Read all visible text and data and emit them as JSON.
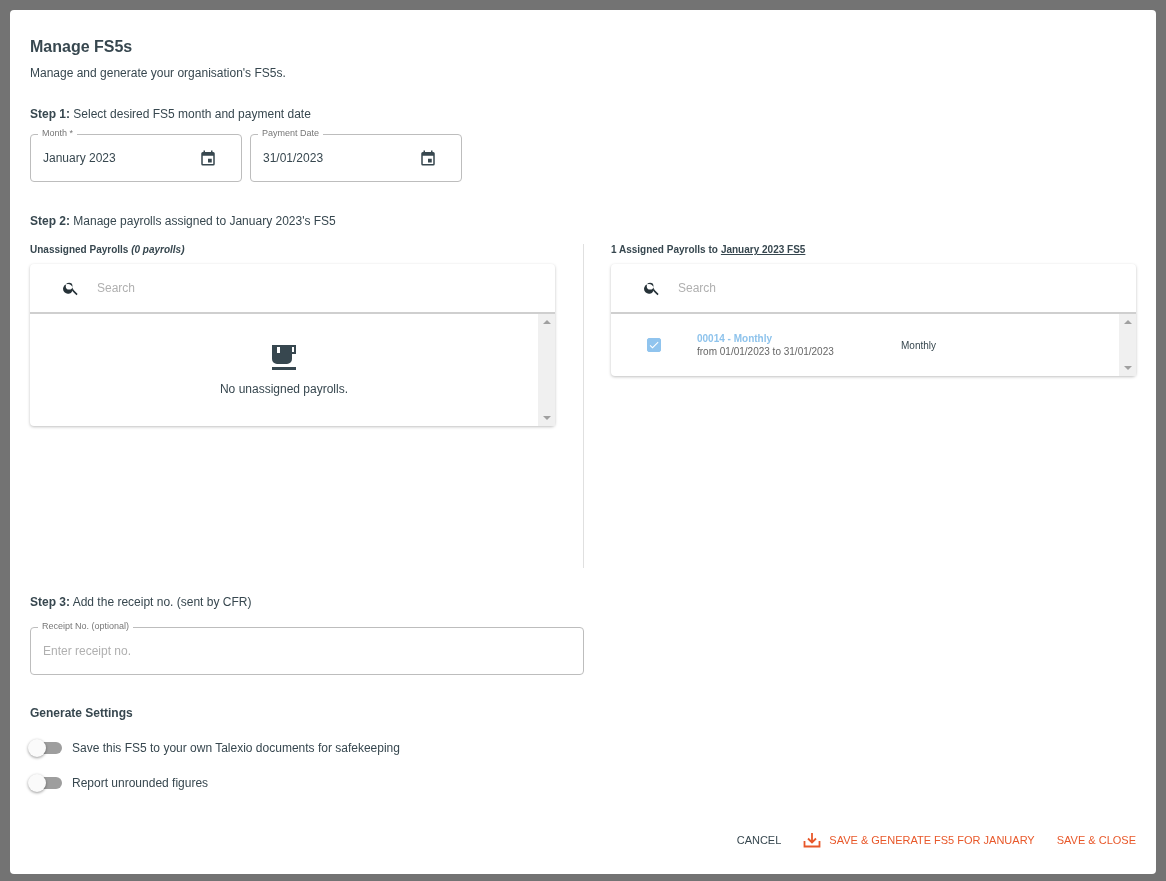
{
  "dialog": {
    "title": "Manage FS5s",
    "subtitle": "Manage and generate your organisation's FS5s."
  },
  "step1": {
    "heading": "**Step 1:** Select desired FS5 month and payment date",
    "fields": [
      {
        "label": "Month *",
        "value": "January 2023"
      },
      {
        "label": "Payment Date",
        "value": "31/01/2023"
      }
    ]
  },
  "step2": {
    "heading": "**Step 2:** Manage payrolls assigned to January 2023's FS5",
    "unassigned": {
      "title": "Unassigned Payrolls *(0 payrolls)*",
      "search_placeholder": "Search",
      "empty_message": "No unassigned payrolls."
    },
    "assigned": {
      "title": "1 Assigned Payrolls to",
      "title_link": "January 2023 FS5",
      "search_placeholder": "Search",
      "rows": [
        {
          "checked": true,
          "name": "00014 - Monthly",
          "period": "from 01/01/2023 to 31/01/2023",
          "frequency": "Monthly"
        }
      ]
    }
  },
  "step3": {
    "heading": "**Step 3:** Add the receipt no. (sent by CFR)",
    "field": {
      "label": "Receipt No. (optional)",
      "placeholder": "Enter receipt no."
    }
  },
  "generate_settings": {
    "heading": "Generate Settings",
    "toggles": [
      {
        "label": "Save this FS5 to your own Talexio documents for safekeeping",
        "on": false
      },
      {
        "label": "Report unrounded figures",
        "on": false
      }
    ]
  },
  "actions": [
    {
      "kind": "plain",
      "label": "CANCEL"
    },
    {
      "kind": "download",
      "label": "SAVE & GENERATE FS5 FOR JANUARY"
    },
    {
      "kind": "accent",
      "label": "SAVE & CLOSE"
    }
  ]
}
